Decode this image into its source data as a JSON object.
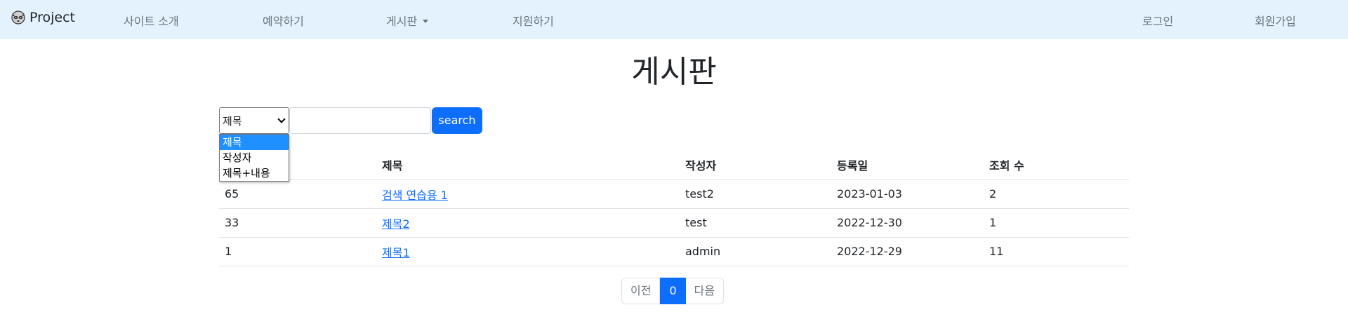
{
  "navbar": {
    "brand": "Project",
    "links": {
      "about": "사이트 소개",
      "reserve": "예약하기",
      "board": "게시판",
      "apply": "지원하기",
      "login": "로그인",
      "signup": "회원가입"
    },
    "background": "#e3f2fd"
  },
  "page_title": "게시판",
  "search": {
    "select_value": "제목",
    "options": [
      "제목",
      "작성자",
      "제목+내용"
    ],
    "input_value": "",
    "button_label": "search"
  },
  "table": {
    "headers": [
      "",
      "제목",
      "작성자",
      "등록일",
      "조회 수"
    ],
    "rows": [
      {
        "no": "65",
        "title": "검색 연습용 1",
        "author": "test2",
        "date": "2023-01-03",
        "views": "2"
      },
      {
        "no": "33",
        "title": "제목2",
        "author": "test",
        "date": "2022-12-30",
        "views": "1"
      },
      {
        "no": "1",
        "title": "제목1",
        "author": "admin",
        "date": "2022-12-29",
        "views": "11"
      }
    ]
  },
  "pagination": {
    "prev": "이전",
    "current": "0",
    "next": "다음"
  },
  "colors": {
    "accent": "#0d6efd",
    "dropdown_highlight": "#1e90ff"
  }
}
